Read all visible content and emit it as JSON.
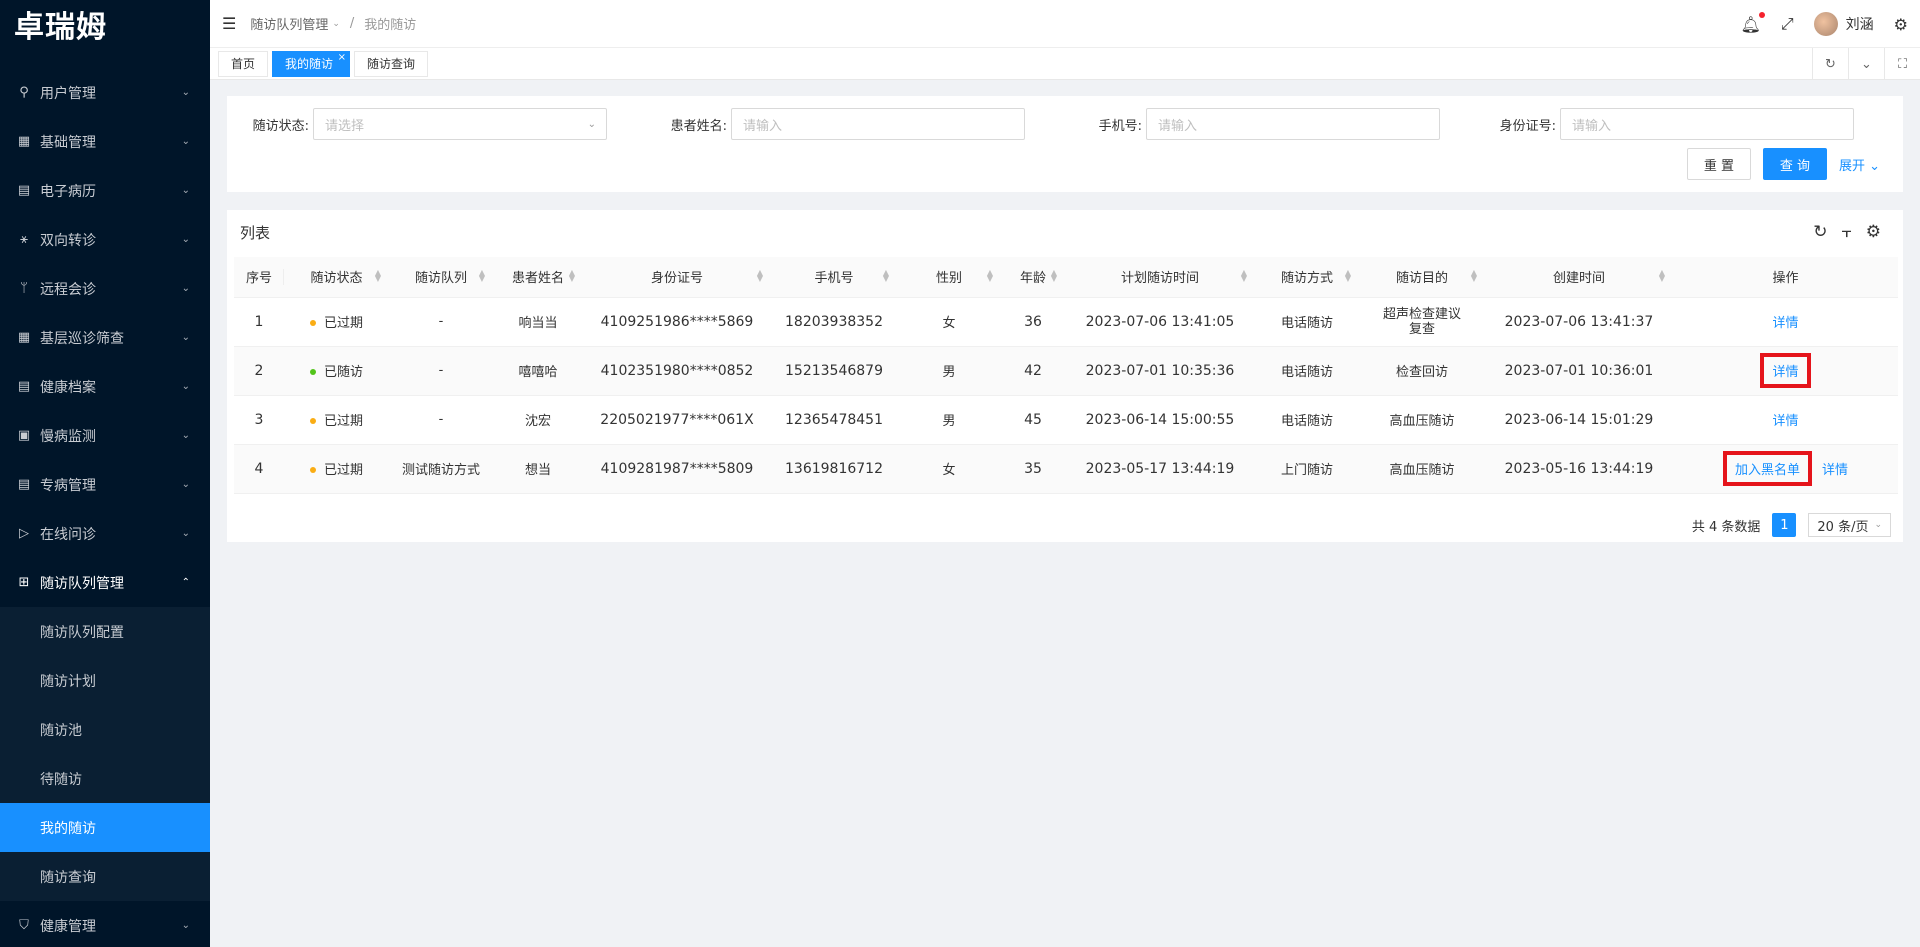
{
  "app": {
    "logo": "卓瑞姆"
  },
  "sidebar": {
    "items": [
      {
        "label": "用户管理",
        "icon": "user-icon"
      },
      {
        "label": "基础管理",
        "icon": "base-icon"
      },
      {
        "label": "电子病历",
        "icon": "record-icon"
      },
      {
        "label": "双向转诊",
        "icon": "transfer-icon"
      },
      {
        "label": "远程会诊",
        "icon": "branch-icon"
      },
      {
        "label": "基层巡诊筛查",
        "icon": "screen-icon"
      },
      {
        "label": "健康档案",
        "icon": "archive-icon"
      },
      {
        "label": "慢病监测",
        "icon": "monitor-icon"
      },
      {
        "label": "专病管理",
        "icon": "disease-icon"
      },
      {
        "label": "在线问诊",
        "icon": "send-icon"
      },
      {
        "label": "随访队列管理",
        "icon": "grid-icon"
      }
    ],
    "subitems": [
      {
        "label": "随访队列配置"
      },
      {
        "label": "随访计划"
      },
      {
        "label": "随访池"
      },
      {
        "label": "待随访"
      },
      {
        "label": "我的随访"
      },
      {
        "label": "随访查询"
      }
    ],
    "after": {
      "label": "健康管理",
      "icon": "shield-icon"
    }
  },
  "header": {
    "breadcrumb": {
      "parent": "随访队列管理",
      "sep": "/",
      "current": "我的随访"
    },
    "user": "刘涵"
  },
  "tabs": [
    {
      "label": "首页"
    },
    {
      "label": "我的随访",
      "close": "×"
    },
    {
      "label": "随访查询"
    }
  ],
  "filters": {
    "status": {
      "label": "随访状态:",
      "placeholder": "请选择"
    },
    "name": {
      "label": "患者姓名:",
      "placeholder": "请输入"
    },
    "phone": {
      "label": "手机号:",
      "placeholder": "请输入"
    },
    "idcard": {
      "label": "身份证号:",
      "placeholder": "请输入"
    },
    "reset": "重 置",
    "search": "查 询",
    "expand": "展开"
  },
  "table": {
    "title": "列表",
    "columns": [
      "序号",
      "随访状态",
      "随访队列",
      "患者姓名",
      "身份证号",
      "手机号",
      "性别",
      "年龄",
      "计划随访时间",
      "随访方式",
      "随访目的",
      "创建时间",
      "操作"
    ],
    "rows": [
      {
        "no": "1",
        "status": "已过期",
        "dot": "#faad14",
        "queue": "-",
        "name": "响当当",
        "idcard": "4109251986****5869",
        "phone": "18203938352",
        "gender": "女",
        "age": "36",
        "plan": "2023-07-06 13:41:05",
        "method": "电话随访",
        "purpose": "超声检查建议复查",
        "created": "2023-07-06 13:41:37",
        "op1": "",
        "op2": "详情"
      },
      {
        "no": "2",
        "status": "已随访",
        "dot": "#52c41a",
        "queue": "-",
        "name": "嘻嘻哈",
        "idcard": "4102351980****0852",
        "phone": "15213546879",
        "gender": "男",
        "age": "42",
        "plan": "2023-07-01 10:35:36",
        "method": "电话随访",
        "purpose": "检查回访",
        "created": "2023-07-01 10:36:01",
        "op1": "",
        "op2": "详情"
      },
      {
        "no": "3",
        "status": "已过期",
        "dot": "#faad14",
        "queue": "-",
        "name": "沈宏",
        "idcard": "2205021977****061X",
        "phone": "12365478451",
        "gender": "男",
        "age": "45",
        "plan": "2023-06-14 15:00:55",
        "method": "电话随访",
        "purpose": "高血压随访",
        "created": "2023-06-14 15:01:29",
        "op1": "",
        "op2": "详情"
      },
      {
        "no": "4",
        "status": "已过期",
        "dot": "#faad14",
        "queue": "测试随访方式",
        "name": "想当",
        "idcard": "4109281987****5809",
        "phone": "13619816712",
        "gender": "女",
        "age": "35",
        "plan": "2023-05-17 13:44:19",
        "method": "上门随访",
        "purpose": "高血压随访",
        "created": "2023-05-16 13:44:19",
        "op1": "加入黑名单",
        "op2": "详情"
      }
    ]
  },
  "pager": {
    "total": "共 4 条数据",
    "page": "1",
    "size": "20 条/页"
  },
  "colors": {
    "primary": "#1890ff",
    "sidebar": "#001529",
    "highlight": "#e5141b"
  }
}
